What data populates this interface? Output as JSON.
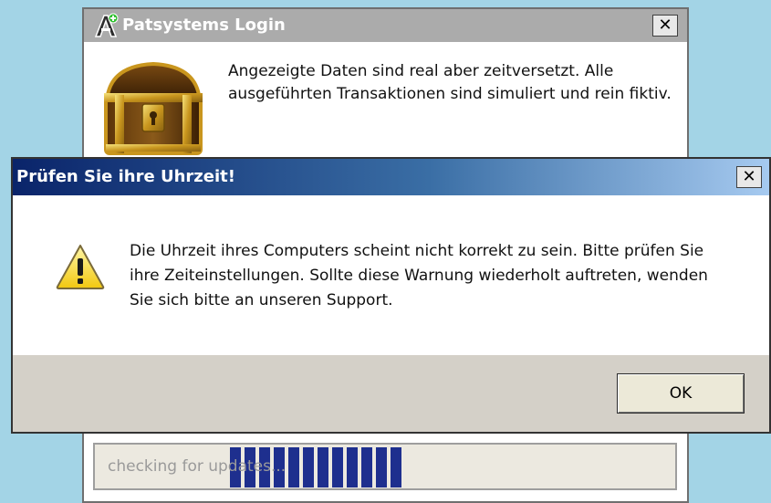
{
  "login_window": {
    "title": "Patsystems Login",
    "close_label": "✕",
    "notice": "Angezeigte Daten sind real aber zeitversetzt. Alle ausgeführten Transaktionen sind simuliert und rein fiktiv.",
    "progress_text": "checking for updates...",
    "progress_segments": 12,
    "icons": [
      "app-logo-icon",
      "treasure-chest-icon"
    ]
  },
  "dialog": {
    "title": "Prüfen Sie ihre Uhrzeit!",
    "close_label": "✕",
    "message": "Die Uhrzeit ihres Computers scheint nicht korrekt zu sein. Bitte prüfen Sie ihre Zeiteinstellungen. Sollte diese Warnung wiederholt auftreten, wenden Sie sich bitte an unseren Support.",
    "ok_label": "OK",
    "icon": "warning-icon"
  },
  "colors": {
    "desktop": "#a3d4e6",
    "titlebar_active_start": "#0a246a",
    "titlebar_active_end": "#a6caf0",
    "titlebar_inactive": "#ababab",
    "dialog_face": "#d4d0c8",
    "progress_fill": "#1e2f8e"
  }
}
